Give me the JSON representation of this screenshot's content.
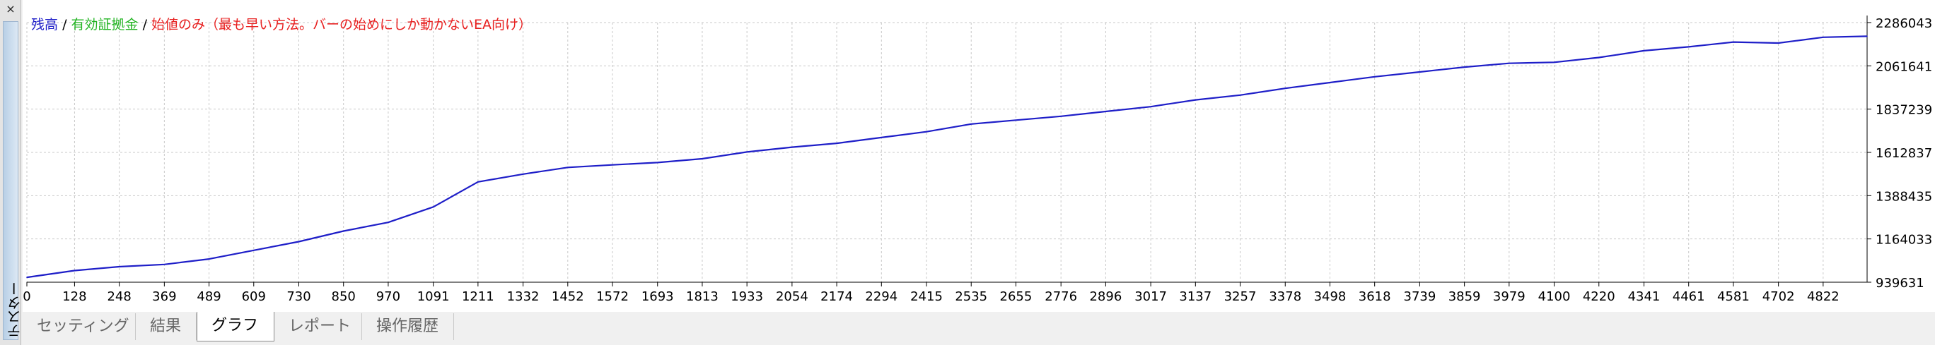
{
  "side_panel": {
    "close_glyph": "×",
    "label": "テスター"
  },
  "legend": {
    "balance": "残高",
    "separator": "/",
    "equity": "有効証拠金",
    "note": "始値のみ（最も早い方法。バーの始めにしか動かないEA向け）",
    "colors": {
      "balance": "#1e1ec8",
      "equity": "#22b422",
      "note": "#e82020"
    }
  },
  "tabs": [
    {
      "label": "セッティング",
      "active": false
    },
    {
      "label": "結果",
      "active": false
    },
    {
      "label": "グラフ",
      "active": true
    },
    {
      "label": "レポート",
      "active": false
    },
    {
      "label": "操作履歴",
      "active": false
    }
  ],
  "chart_data": {
    "type": "line",
    "series": [
      {
        "name": "残高",
        "color": "#1e1ec8",
        "x": [
          0,
          128,
          248,
          369,
          489,
          609,
          730,
          850,
          970,
          1091,
          1211,
          1332,
          1452,
          1572,
          1693,
          1813,
          1933,
          2054,
          2174,
          2294,
          2415,
          2535,
          2655,
          2776,
          2896,
          3017,
          3137,
          3257,
          3378,
          3498,
          3618,
          3739,
          3859,
          3979,
          4100,
          4220,
          4341,
          4461,
          4581,
          4702,
          4822,
          4940
        ],
        "y": [
          965000,
          1000000,
          1020000,
          1032000,
          1060000,
          1105000,
          1150000,
          1205000,
          1250000,
          1330000,
          1460000,
          1500000,
          1535000,
          1548000,
          1560000,
          1580000,
          1615000,
          1640000,
          1660000,
          1690000,
          1720000,
          1760000,
          1780000,
          1800000,
          1825000,
          1850000,
          1885000,
          1910000,
          1945000,
          1975000,
          2005000,
          2030000,
          2055000,
          2075000,
          2080000,
          2105000,
          2140000,
          2160000,
          2185000,
          2180000,
          2210000,
          2215000
        ]
      }
    ],
    "x_ticks": [
      0,
      128,
      248,
      369,
      489,
      609,
      730,
      850,
      970,
      1091,
      1211,
      1332,
      1452,
      1572,
      1693,
      1813,
      1933,
      2054,
      2174,
      2294,
      2415,
      2535,
      2655,
      2776,
      2896,
      3017,
      3137,
      3257,
      3378,
      3498,
      3618,
      3739,
      3859,
      3979,
      4100,
      4220,
      4341,
      4461,
      4581,
      4702,
      4822
    ],
    "y_ticks": [
      939631,
      1164033,
      1388435,
      1612837,
      1837239,
      2061641,
      2286043
    ],
    "xlim": [
      0,
      4940
    ],
    "ylim": [
      939631,
      2286043
    ],
    "grid": true,
    "axis_color": "#000000",
    "grid_color": "#c8c8c8"
  }
}
